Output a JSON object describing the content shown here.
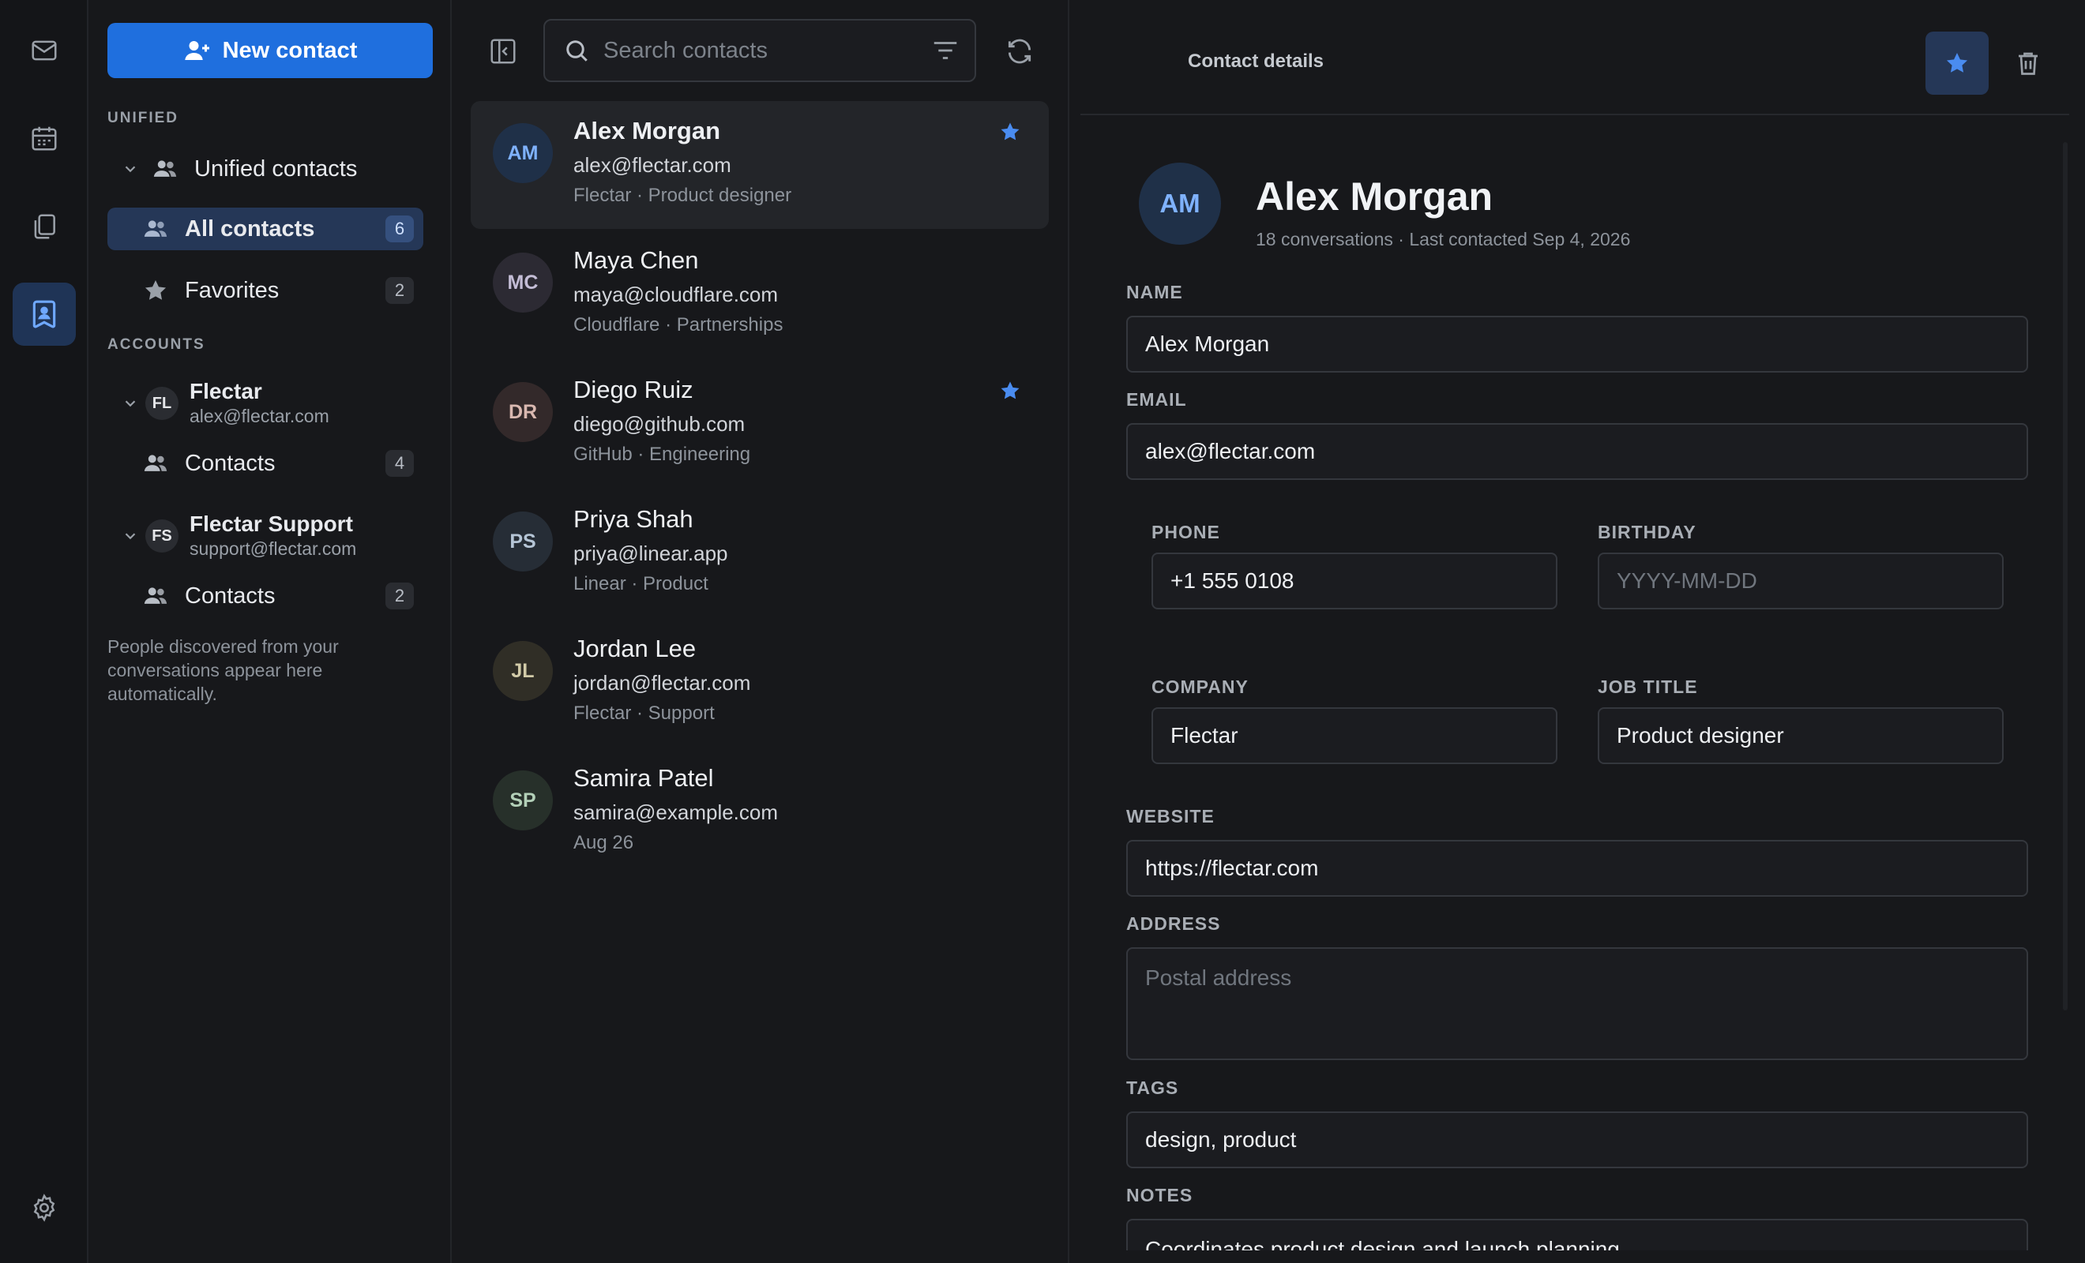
{
  "rail": {
    "items": [
      "mail-icon",
      "calendar-icon",
      "files-icon",
      "contacts-icon",
      "gear-icon"
    ]
  },
  "sidebar": {
    "new_contact": "New contact",
    "unified_title": "UNIFIED",
    "unified_contacts": "Unified contacts",
    "all_contacts": "All contacts",
    "all_count": "6",
    "favorites": "Favorites",
    "favorites_count": "2",
    "accounts_title": "ACCOUNTS",
    "accounts": [
      {
        "initials": "FL",
        "name": "Flectar",
        "email": "alex@flectar.com",
        "contacts_label": "Contacts",
        "count": "4"
      },
      {
        "initials": "FS",
        "name": "Flectar Support",
        "email": "support@flectar.com",
        "contacts_label": "Contacts",
        "count": "2"
      }
    ],
    "note": "People discovered from your conversations appear here automatically."
  },
  "list": {
    "search_placeholder": "Search contacts",
    "contacts": [
      {
        "initials": "AM",
        "name": "Alex Morgan",
        "email": "alex@flectar.com",
        "sub": "Flectar · Product designer",
        "starred": true,
        "avatar_bg": "#1f3048",
        "avatar_fg": "#7fb2ff"
      },
      {
        "initials": "MC",
        "name": "Maya Chen",
        "email": "maya@cloudflare.com",
        "sub": "Cloudflare · Partnerships",
        "starred": false,
        "avatar_bg": "#2c2a33",
        "avatar_fg": "#c4bdd6"
      },
      {
        "initials": "DR",
        "name": "Diego Ruiz",
        "email": "diego@github.com",
        "sub": "GitHub · Engineering",
        "starred": true,
        "avatar_bg": "#33292a",
        "avatar_fg": "#d9b8b0"
      },
      {
        "initials": "PS",
        "name": "Priya Shah",
        "email": "priya@linear.app",
        "sub": "Linear · Product",
        "starred": false,
        "avatar_bg": "#262d36",
        "avatar_fg": "#b5c5d6"
      },
      {
        "initials": "JL",
        "name": "Jordan Lee",
        "email": "jordan@flectar.com",
        "sub": "Flectar · Support",
        "starred": false,
        "avatar_bg": "#302e26",
        "avatar_fg": "#d2cba8"
      },
      {
        "initials": "SP",
        "name": "Samira Patel",
        "email": "samira@example.com",
        "sub": "Aug 26",
        "starred": false,
        "avatar_bg": "#27302a",
        "avatar_fg": "#b3d0b8"
      }
    ]
  },
  "details": {
    "header_title": "Contact details",
    "initials": "AM",
    "name": "Alex Morgan",
    "meta": "18 conversations · Last contacted Sep 4, 2026",
    "fields": {
      "name_label": "NAME",
      "name_value": "Alex Morgan",
      "email_label": "EMAIL",
      "email_value": "alex@flectar.com",
      "phone_label": "PHONE",
      "phone_value": "+1 555 0108",
      "birthday_label": "BIRTHDAY",
      "birthday_placeholder": "YYYY-MM-DD",
      "company_label": "COMPANY",
      "company_value": "Flectar",
      "job_label": "JOB TITLE",
      "job_value": "Product designer",
      "website_label": "WEBSITE",
      "website_value": "https://flectar.com",
      "address_label": "ADDRESS",
      "address_placeholder": "Postal address",
      "tags_label": "TAGS",
      "tags_value": "design, product",
      "notes_label": "NOTES",
      "notes_value": "Coordinates product design and launch planning."
    }
  },
  "colors": {
    "accent": "#1f6fde",
    "star": "#4a8cf0",
    "selected": "#253757"
  }
}
